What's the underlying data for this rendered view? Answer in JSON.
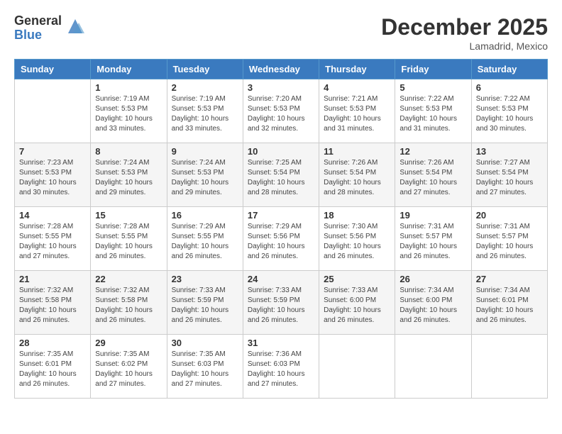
{
  "logo": {
    "general": "General",
    "blue": "Blue"
  },
  "title": "December 2025",
  "location": "Lamadrid, Mexico",
  "days_of_week": [
    "Sunday",
    "Monday",
    "Tuesday",
    "Wednesday",
    "Thursday",
    "Friday",
    "Saturday"
  ],
  "weeks": [
    [
      {
        "day": "",
        "info": ""
      },
      {
        "day": "1",
        "info": "Sunrise: 7:19 AM\nSunset: 5:53 PM\nDaylight: 10 hours\nand 33 minutes."
      },
      {
        "day": "2",
        "info": "Sunrise: 7:19 AM\nSunset: 5:53 PM\nDaylight: 10 hours\nand 33 minutes."
      },
      {
        "day": "3",
        "info": "Sunrise: 7:20 AM\nSunset: 5:53 PM\nDaylight: 10 hours\nand 32 minutes."
      },
      {
        "day": "4",
        "info": "Sunrise: 7:21 AM\nSunset: 5:53 PM\nDaylight: 10 hours\nand 31 minutes."
      },
      {
        "day": "5",
        "info": "Sunrise: 7:22 AM\nSunset: 5:53 PM\nDaylight: 10 hours\nand 31 minutes."
      },
      {
        "day": "6",
        "info": "Sunrise: 7:22 AM\nSunset: 5:53 PM\nDaylight: 10 hours\nand 30 minutes."
      }
    ],
    [
      {
        "day": "7",
        "info": "Sunrise: 7:23 AM\nSunset: 5:53 PM\nDaylight: 10 hours\nand 30 minutes."
      },
      {
        "day": "8",
        "info": "Sunrise: 7:24 AM\nSunset: 5:53 PM\nDaylight: 10 hours\nand 29 minutes."
      },
      {
        "day": "9",
        "info": "Sunrise: 7:24 AM\nSunset: 5:53 PM\nDaylight: 10 hours\nand 29 minutes."
      },
      {
        "day": "10",
        "info": "Sunrise: 7:25 AM\nSunset: 5:54 PM\nDaylight: 10 hours\nand 28 minutes."
      },
      {
        "day": "11",
        "info": "Sunrise: 7:26 AM\nSunset: 5:54 PM\nDaylight: 10 hours\nand 28 minutes."
      },
      {
        "day": "12",
        "info": "Sunrise: 7:26 AM\nSunset: 5:54 PM\nDaylight: 10 hours\nand 27 minutes."
      },
      {
        "day": "13",
        "info": "Sunrise: 7:27 AM\nSunset: 5:54 PM\nDaylight: 10 hours\nand 27 minutes."
      }
    ],
    [
      {
        "day": "14",
        "info": "Sunrise: 7:28 AM\nSunset: 5:55 PM\nDaylight: 10 hours\nand 27 minutes."
      },
      {
        "day": "15",
        "info": "Sunrise: 7:28 AM\nSunset: 5:55 PM\nDaylight: 10 hours\nand 26 minutes."
      },
      {
        "day": "16",
        "info": "Sunrise: 7:29 AM\nSunset: 5:55 PM\nDaylight: 10 hours\nand 26 minutes."
      },
      {
        "day": "17",
        "info": "Sunrise: 7:29 AM\nSunset: 5:56 PM\nDaylight: 10 hours\nand 26 minutes."
      },
      {
        "day": "18",
        "info": "Sunrise: 7:30 AM\nSunset: 5:56 PM\nDaylight: 10 hours\nand 26 minutes."
      },
      {
        "day": "19",
        "info": "Sunrise: 7:31 AM\nSunset: 5:57 PM\nDaylight: 10 hours\nand 26 minutes."
      },
      {
        "day": "20",
        "info": "Sunrise: 7:31 AM\nSunset: 5:57 PM\nDaylight: 10 hours\nand 26 minutes."
      }
    ],
    [
      {
        "day": "21",
        "info": "Sunrise: 7:32 AM\nSunset: 5:58 PM\nDaylight: 10 hours\nand 26 minutes."
      },
      {
        "day": "22",
        "info": "Sunrise: 7:32 AM\nSunset: 5:58 PM\nDaylight: 10 hours\nand 26 minutes."
      },
      {
        "day": "23",
        "info": "Sunrise: 7:33 AM\nSunset: 5:59 PM\nDaylight: 10 hours\nand 26 minutes."
      },
      {
        "day": "24",
        "info": "Sunrise: 7:33 AM\nSunset: 5:59 PM\nDaylight: 10 hours\nand 26 minutes."
      },
      {
        "day": "25",
        "info": "Sunrise: 7:33 AM\nSunset: 6:00 PM\nDaylight: 10 hours\nand 26 minutes."
      },
      {
        "day": "26",
        "info": "Sunrise: 7:34 AM\nSunset: 6:00 PM\nDaylight: 10 hours\nand 26 minutes."
      },
      {
        "day": "27",
        "info": "Sunrise: 7:34 AM\nSunset: 6:01 PM\nDaylight: 10 hours\nand 26 minutes."
      }
    ],
    [
      {
        "day": "28",
        "info": "Sunrise: 7:35 AM\nSunset: 6:01 PM\nDaylight: 10 hours\nand 26 minutes."
      },
      {
        "day": "29",
        "info": "Sunrise: 7:35 AM\nSunset: 6:02 PM\nDaylight: 10 hours\nand 27 minutes."
      },
      {
        "day": "30",
        "info": "Sunrise: 7:35 AM\nSunset: 6:03 PM\nDaylight: 10 hours\nand 27 minutes."
      },
      {
        "day": "31",
        "info": "Sunrise: 7:36 AM\nSunset: 6:03 PM\nDaylight: 10 hours\nand 27 minutes."
      },
      {
        "day": "",
        "info": ""
      },
      {
        "day": "",
        "info": ""
      },
      {
        "day": "",
        "info": ""
      }
    ]
  ]
}
